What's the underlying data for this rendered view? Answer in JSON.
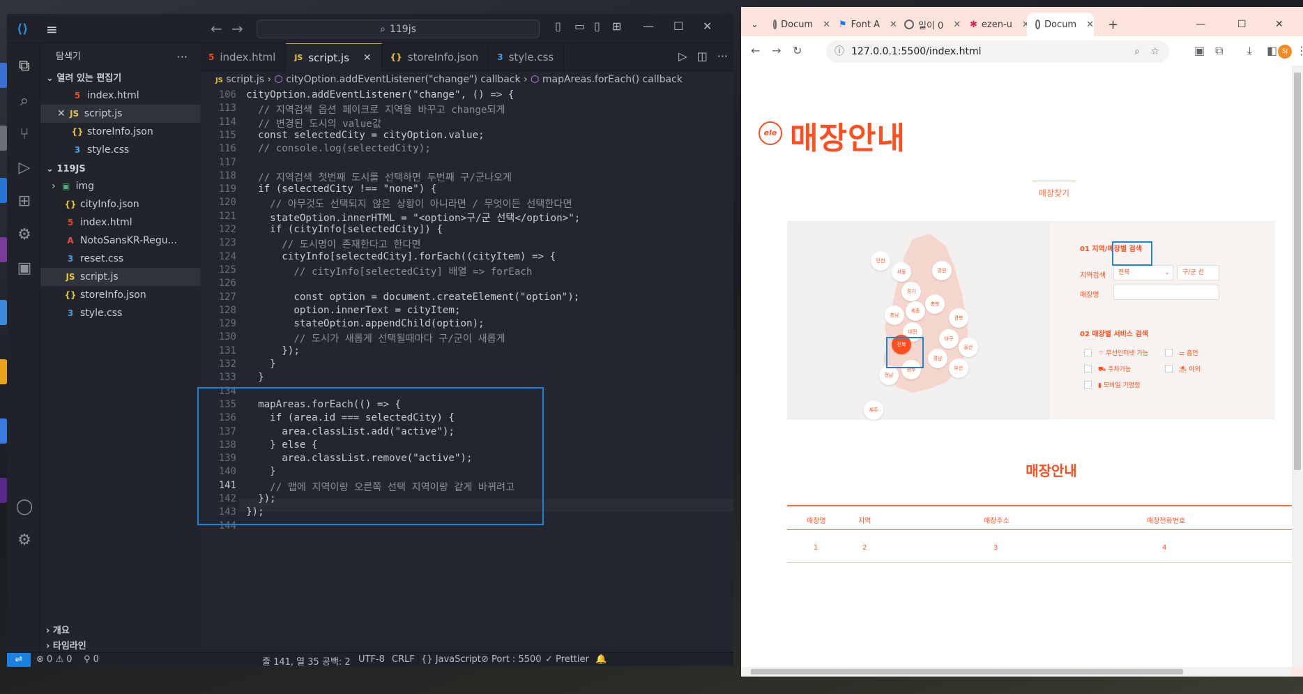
{
  "vscode": {
    "search": "119js",
    "sidebar_title": "탐색기",
    "open_editors_label": "열려 있는 편집기",
    "open_editors": [
      {
        "name": "index.html",
        "icon": "html"
      },
      {
        "name": "script.js",
        "icon": "js"
      },
      {
        "name": "storeInfo.json",
        "icon": "json"
      },
      {
        "name": "style.css",
        "icon": "css"
      }
    ],
    "folder_label": "119JS",
    "files": [
      {
        "name": "img",
        "icon": "folder"
      },
      {
        "name": "cityInfo.json",
        "icon": "json"
      },
      {
        "name": "index.html",
        "icon": "html"
      },
      {
        "name": "NotoSansKR-Regu...",
        "icon": "font"
      },
      {
        "name": "reset.css",
        "icon": "css"
      },
      {
        "name": "script.js",
        "icon": "js"
      },
      {
        "name": "storeInfo.json",
        "icon": "json"
      },
      {
        "name": "style.css",
        "icon": "css"
      }
    ],
    "outline_label": "개요",
    "timeline_label": "타임라인",
    "tabs": [
      {
        "label": "index.html",
        "icon": "html"
      },
      {
        "label": "script.js",
        "icon": "js"
      },
      {
        "label": "storeInfo.json",
        "icon": "json"
      },
      {
        "label": "style.css",
        "icon": "css"
      }
    ],
    "breadcrumb": [
      "script.js",
      "cityOption.addEventListener(\"change\") callback",
      "mapAreas.forEach() callback"
    ],
    "line_numbers": [
      "106",
      "113",
      "114",
      "115",
      "116",
      "117",
      "118",
      "119",
      "120",
      "121",
      "122",
      "123",
      "124",
      "125",
      "126",
      "127",
      "128",
      "129",
      "130",
      "131",
      "132",
      "133",
      "134",
      "135",
      "136",
      "137",
      "138",
      "139",
      "140",
      "141",
      "142",
      "143",
      "144"
    ],
    "code_lines": [
      "cityOption.addEventListener(\"change\", () => {",
      "  // 지역검색 옵션 페이크로 지역을 바꾸고 change되게",
      "  // 변경된 도시의 value값",
      "  const selectedCity = cityOption.value;",
      "  // console.log(selectedCity);",
      "",
      "  // 지역검색 첫번째 도시를 선택하면 두번째 구/군나오게",
      "  if (selectedCity !== \"none\") {",
      "    // 아무것도 선택되지 않은 상황이 아니라면 / 무엇이든 선택한다면",
      "    stateOption.innerHTML = \"<option>구/군 선택</option>\";",
      "    if (cityInfo[selectedCity]) {",
      "      // 도시명이 존재한다고 한다면",
      "      cityInfo[selectedCity].forEach((cityItem) => {",
      "        // cityInfo[selectedCity] 배열 => forEach",
      "",
      "        const option = document.createElement(\"option\");",
      "        option.innerText = cityItem;",
      "        stateOption.appendChild(option);",
      "        // 도시가 새롭게 선택될때마다 구/군이 새롭게",
      "      });",
      "    }",
      "  }",
      "",
      "  mapAreas.forEach(() => {",
      "    if (area.id === selectedCity) {",
      "      area.classList.add(\"active\");",
      "    } else {",
      "      area.classList.remove(\"active\");",
      "    }",
      "    // 맵에 지역이랑 오른쪽 선택 지역이랑 같게 바뀌려고",
      "  });",
      "});",
      ""
    ],
    "status": {
      "errors": "0",
      "warnings": "0",
      "ports": "0",
      "position": "줄 141, 열 35",
      "spaces": "공백: 2",
      "encoding": "UTF-8",
      "eol": "CRLF",
      "language": "JavaScript",
      "port": "Port : 5500",
      "prettier": "Prettier"
    }
  },
  "browser": {
    "tabs": [
      {
        "label": "Docum"
      },
      {
        "label": "Font A"
      },
      {
        "label": "일이 0"
      },
      {
        "label": "ezen-u"
      },
      {
        "label": "Docum"
      }
    ],
    "url": "127.0.0.1:5500/index.html",
    "profile": "SJ",
    "page": {
      "logo": "ele",
      "title": "매장안내",
      "find_tab": "매장찾기",
      "section1": "01 지역/매장별 검색",
      "region_label": "지역검색",
      "region_value": "전북",
      "district_value": "구/군 선",
      "store_label": "매장명",
      "section2": "02 매장별 서비스 검색",
      "services": [
        "무선인터넷 가능",
        "주차가능",
        "모바일 기명점",
        "흡연",
        "야외"
      ],
      "regions": [
        "인천",
        "서울",
        "강원",
        "경기",
        "충북",
        "충남",
        "세종",
        "경북",
        "대전",
        "전북",
        "대구",
        "울산",
        "광주",
        "경남",
        "부산",
        "전남",
        "제주"
      ],
      "list_title": "매장안내",
      "table_headers": [
        "매장명",
        "지역",
        "매장주소",
        "매장전화번호"
      ],
      "table_row": [
        "1",
        "2",
        "3",
        "4"
      ]
    }
  }
}
